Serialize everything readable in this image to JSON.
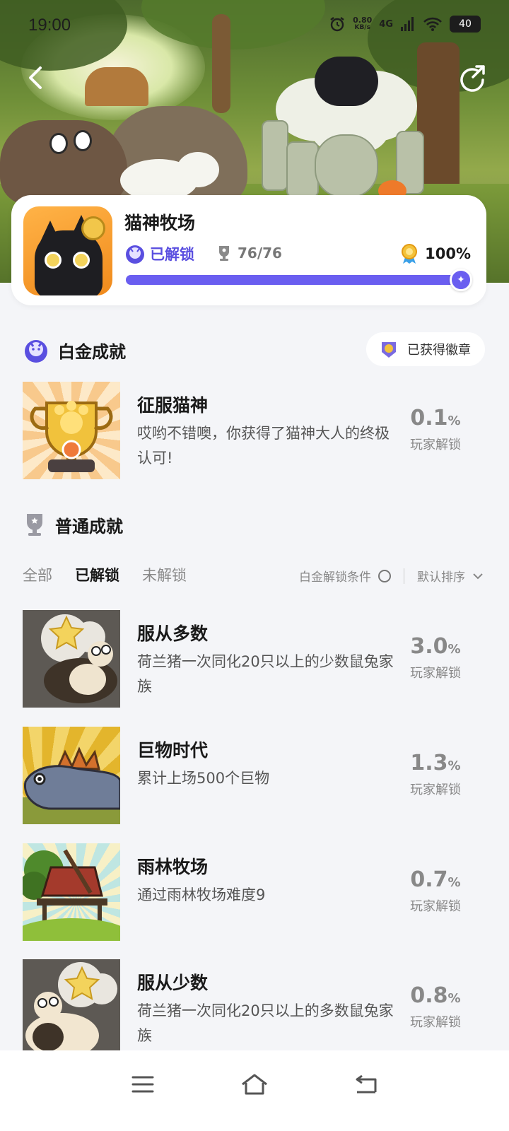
{
  "status_bar": {
    "time": "19:00",
    "net_speed": "0.80",
    "net_unit": "KB/s",
    "signal": "4G",
    "battery": "40"
  },
  "game": {
    "title": "猫神牧场",
    "unlock_state": "已解锁",
    "trophy_count": "76/76",
    "completion": "100%",
    "progress": 1.0
  },
  "platinum_section": {
    "title": "白金成就",
    "badge_button": "已获得徽章"
  },
  "platinum_achievement": {
    "name": "征服猫神",
    "desc": "哎哟不错噢，你获得了猫神大人的终极认可!",
    "pct": "0.1",
    "pct_unit": "%",
    "pct_label": "玩家解锁"
  },
  "normal_section": {
    "title": "普通成就"
  },
  "tabs": {
    "all": "全部",
    "unlocked": "已解锁",
    "locked": "未解锁"
  },
  "filters": {
    "platinum_condition": "白金解锁条件",
    "sort": "默认排序"
  },
  "achievements": [
    {
      "name": "服从多数",
      "desc": "荷兰猪一次同化20只以上的少数鼠兔家族",
      "pct": "3.0",
      "pct_unit": "%",
      "pct_label": "玩家解锁"
    },
    {
      "name": "巨物时代",
      "desc": "累计上场500个巨物",
      "pct": "1.3",
      "pct_unit": "%",
      "pct_label": "玩家解锁"
    },
    {
      "name": "雨林牧场",
      "desc": "通过雨林牧场难度9",
      "pct": "0.7",
      "pct_unit": "%",
      "pct_label": "玩家解锁"
    },
    {
      "name": "服从少数",
      "desc": "荷兰猪一次同化20只以上的多数鼠兔家族",
      "pct": "0.8",
      "pct_unit": "%",
      "pct_label": "玩家解锁"
    }
  ],
  "colors": {
    "accent": "#6a5ef0",
    "background": "#f4f5f8"
  }
}
